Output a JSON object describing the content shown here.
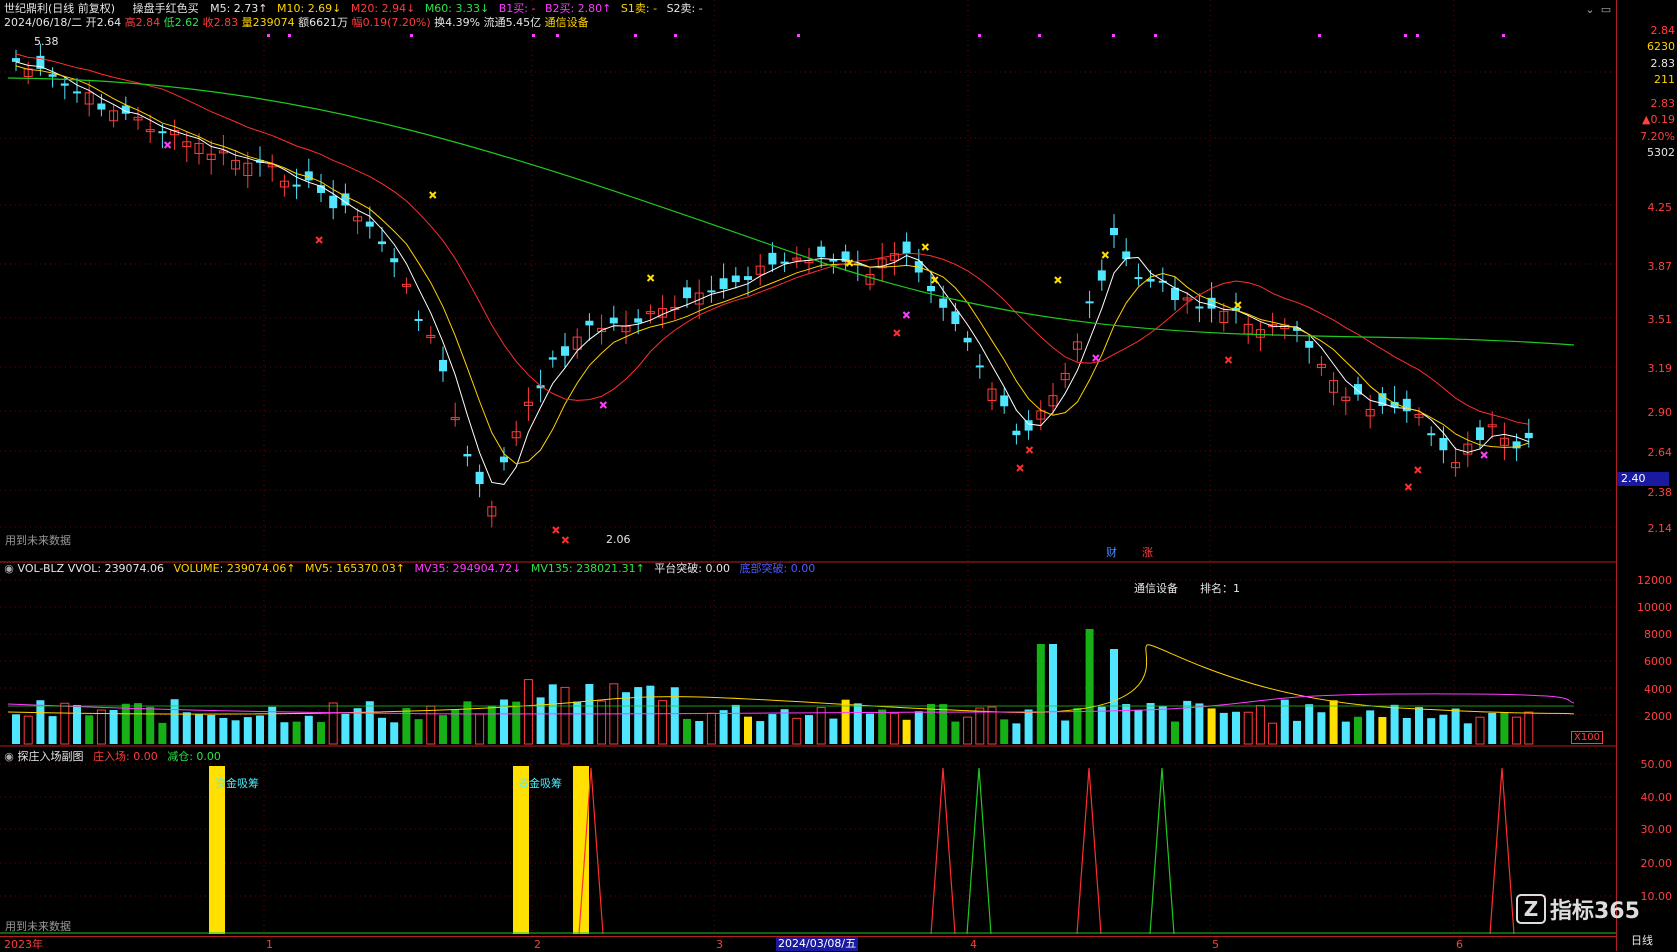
{
  "colors": {
    "up": "#ff3c3c",
    "down": "#50e6ff",
    "ma5": "#ffffff",
    "ma10": "#ffd200",
    "ma20": "#ff2e2e",
    "ma60": "#1fc81f",
    "grid": "#7a0000",
    "magenta": "#ff3cff",
    "yellow": "#ffe000",
    "green": "#16b016"
  },
  "header": {
    "name": "世纪鼎利(日线 前复权)",
    "indicator": "操盘手红色买",
    "ma5": "M5: 2.73↑",
    "ma10": "M10: 2.69↓",
    "ma20": "M20: 2.94↓",
    "ma60": "M60: 3.33↓",
    "b1": "B1买: -",
    "b2": "B2买: 2.80↑",
    "s1": "S1卖: -",
    "s2": "S2卖: -",
    "row2_date": "2024/06/18/二",
    "row2_open": "开2.64",
    "row2_high": "高2.84",
    "row2_low": "低2.62",
    "row2_close": "收2.83",
    "row2_vol": "量239074",
    "row2_amt": "额6621万",
    "row2_chg": "幅0.19(7.20%)",
    "row2_turn": "换4.39%",
    "row2_float": "流通5.45亿",
    "row2_sector": "通信设备"
  },
  "price_pane": {
    "high_mark": "5.38",
    "low_mark": "2.06",
    "note": "用到未来数据",
    "bottom_labels": [
      "财",
      "涨"
    ],
    "axis": [
      "4.25",
      "3.87",
      "3.51",
      "3.19",
      "2.90",
      "2.64",
      "2.38",
      "2.14"
    ],
    "current_price": "2.40"
  },
  "quote_box": [
    "2.84",
    "6230",
    "2.83",
    "211",
    "2.83",
    "▲0.19",
    "7.20%",
    "5302"
  ],
  "volume_pane": {
    "name": "VOL-BLZ",
    "vol": "VVOL: 239074.06",
    "volume": "VOLUME: 239074.06↑",
    "mv5": "MV5: 165370.03↑",
    "mv35": "MV35: 294904.72↓",
    "mv135": "MV135: 238021.31↑",
    "breakout": "平台突破: 0.00",
    "bottom_break": "底部突破: 0.00",
    "annotation_sector": "通信设备",
    "annotation_rank": "排名：1",
    "axis": [
      "12000",
      "10000",
      "8000",
      "6000",
      "4000",
      "2000"
    ],
    "unit": "X100"
  },
  "sub_pane": {
    "name": "探庄入场副图",
    "enter": "庄入场: 0.00",
    "reduce": "减仓: 0.00",
    "labels": [
      "资金吸筹",
      "资金吸筹"
    ],
    "note": "用到未来数据",
    "axis": [
      "50.00",
      "40.00",
      "30.00",
      "20.00",
      "10.00"
    ]
  },
  "timeline": {
    "start": "2023年",
    "marks": [
      "1",
      "2",
      "3",
      "4",
      "5",
      "6"
    ],
    "highlight": "2024/03/08/五"
  },
  "corner": {
    "period": "日线",
    "brand": "指标365"
  }
}
